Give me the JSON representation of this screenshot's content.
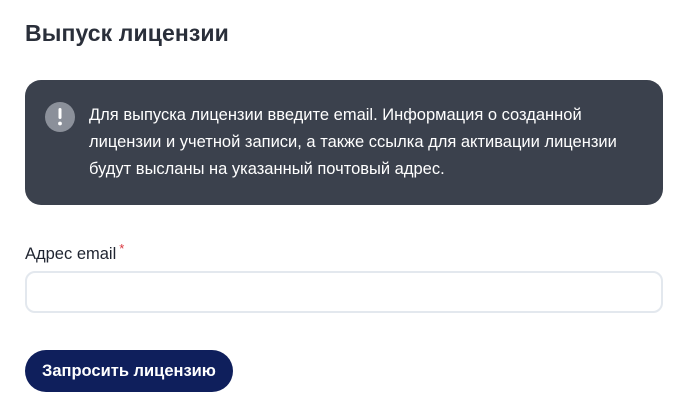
{
  "page": {
    "title": "Выпуск лицензии"
  },
  "notice": {
    "icon": "exclamation-icon",
    "text": "Для выпуска лицензии введите email. Информация о созданной лицензии и учетной записи, а также ссылка для активации лицензии будут высланы на указанный почтовый адрес."
  },
  "form": {
    "email_label": "Адрес email",
    "required_mark": "*",
    "email_value": "",
    "email_placeholder": ""
  },
  "actions": {
    "submit_label": "Запросить лицензию"
  },
  "colors": {
    "panel_background": "#3b414d",
    "button_background": "#0f1f5c",
    "required_mark": "#d9363e"
  }
}
